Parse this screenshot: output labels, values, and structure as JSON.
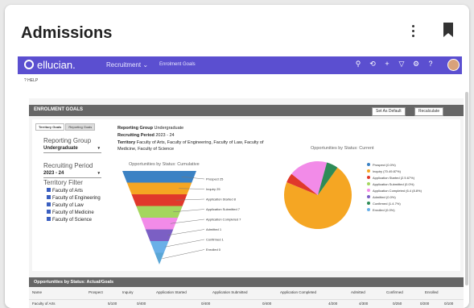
{
  "card": {
    "title": "Admissions"
  },
  "topbar": {
    "logo": "ellucian.",
    "module": "Recruitment",
    "page": "Enrolment Goals",
    "icons": [
      "search-icon",
      "history-icon",
      "add-icon",
      "filter-icon",
      "settings-icon",
      "help-icon"
    ]
  },
  "help_label": "HELP",
  "section": {
    "title": "ENROLMENT GOALS",
    "set_default": "Set As Default",
    "recalculate": "Recalculate"
  },
  "tabs": [
    "Territory Goals",
    "Reporting Goals"
  ],
  "filters": {
    "reporting_group_label": "Reporting Group",
    "reporting_group_value": "Undergraduate",
    "recruiting_period_label": "Recruiting Period",
    "recruiting_period_value": "2023 - 24",
    "territory_label": "Territory Filter",
    "territories": [
      "Faculty of Arts",
      "Faculty of Engineering",
      "Faculty of Law",
      "Faculty of Medicine",
      "Faculty of Science"
    ]
  },
  "info": {
    "group_label": "Reporting Group",
    "group_value": "Undergraduate",
    "period_label": "Recruiting Period",
    "period_value": "2023 - 24",
    "territory_label": "Territory",
    "territory_line1": "Faculty of Arts, Faculty of Engineering, Faculty of Law, Faculty of",
    "territory_line2": "Medicine, Faculty of Science"
  },
  "funnel": {
    "title": "Opportunities by Status: Cumulative",
    "stages": [
      {
        "label": "Prospect 25",
        "color": "#3b82c4"
      },
      {
        "label": "Inquiry 25",
        "color": "#f5a623"
      },
      {
        "label": "Application Started 8",
        "color": "#e0382b"
      },
      {
        "label": "Application Submitted 7",
        "color": "#a4d65e"
      },
      {
        "label": "Application Completed 7",
        "color": "#f28be8"
      },
      {
        "label": "Admitted 1",
        "color": "#7b5fc4"
      },
      {
        "label": "Confirmed 1",
        "color": "#6ab0e8"
      },
      {
        "label": "Enrolled 0",
        "color": "#5aa6d6"
      }
    ]
  },
  "pie": {
    "title": "Opportunities by Status: Current",
    "legend": [
      "Prospect (0.0%)",
      "Inquiry (70.49.87%)",
      "Application Started (2.5.67%)",
      "Application Submitted (0.0%)",
      "Application Completed (6.4 (8.8%)",
      "Admitted (0.0%)",
      "Confirmed (1.4.7%)",
      "Enrolled (0.0%)"
    ]
  },
  "chart_data": {
    "type": "pie",
    "title": "Opportunities by Status: Current",
    "categories": [
      "Prospect",
      "Inquiry",
      "Application Started",
      "Application Submitted",
      "Application Completed",
      "Admitted",
      "Confirmed",
      "Enrolled"
    ],
    "values": [
      0,
      70.5,
      4.5,
      0,
      18.3,
      0,
      5.5,
      0
    ],
    "colors": [
      "#3b82c4",
      "#f5a623",
      "#e0382b",
      "#a4d65e",
      "#f28be8",
      "#7b5fc4",
      "#2e8b57",
      "#6ab0e8"
    ]
  },
  "table": {
    "title": "Opportunities by Status: Actual/Goals",
    "headers": [
      "Name",
      "Prospect",
      "Inquiry",
      "Application Started",
      "Application Submitted",
      "Application Completed",
      "Admitted",
      "Confirmed",
      "Enrolled"
    ],
    "row": [
      "Faculty of Arts",
      "5/100",
      "0/400",
      "0/400",
      "0/400",
      "4/200",
      "4/300",
      "0/250",
      "0/200",
      "0/100"
    ]
  }
}
